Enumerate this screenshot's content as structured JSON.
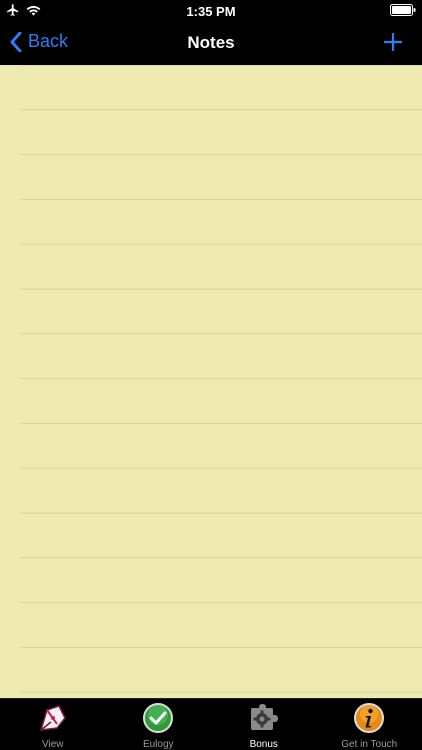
{
  "status_bar": {
    "time": "1:35 PM",
    "icons": [
      "airplane-icon",
      "wifi-icon",
      "battery-icon"
    ]
  },
  "nav": {
    "back_label": "Back",
    "title": "Notes",
    "add_icon": "plus-icon",
    "accent_color": "#2f7cf6"
  },
  "notepad": {
    "text": "",
    "paper_color": "#efe9b2",
    "line_color": "#d9d4a0"
  },
  "tabs": [
    {
      "label": "View",
      "icon": "pen-nib-icon",
      "selected": false
    },
    {
      "label": "Eulogy",
      "icon": "checkmark-icon",
      "selected": false
    },
    {
      "label": "Bonus",
      "icon": "puzzle-gear-icon",
      "selected": true
    },
    {
      "label": "Get in Touch",
      "icon": "info-icon",
      "selected": false
    }
  ]
}
